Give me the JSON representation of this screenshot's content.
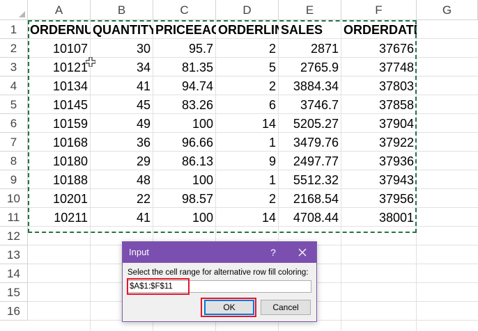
{
  "columns": [
    "A",
    "B",
    "C",
    "D",
    "E",
    "F",
    "G"
  ],
  "rows": [
    "1",
    "2",
    "3",
    "4",
    "5",
    "6",
    "7",
    "8",
    "9",
    "10",
    "11",
    "12",
    "13",
    "14",
    "15",
    "16"
  ],
  "headers": [
    "ORDERNU",
    "QUANTITY",
    "PRICEEAC",
    "ORDERLIN",
    "SALES",
    "ORDERDATE"
  ],
  "data": [
    [
      "10107",
      "30",
      "95.7",
      "2",
      "2871",
      "37676"
    ],
    [
      "10121",
      "34",
      "81.35",
      "5",
      "2765.9",
      "37748"
    ],
    [
      "10134",
      "41",
      "94.74",
      "2",
      "3884.34",
      "37803"
    ],
    [
      "10145",
      "45",
      "83.26",
      "6",
      "3746.7",
      "37858"
    ],
    [
      "10159",
      "49",
      "100",
      "14",
      "5205.27",
      "37904"
    ],
    [
      "10168",
      "36",
      "96.66",
      "1",
      "3479.76",
      "37922"
    ],
    [
      "10180",
      "29",
      "86.13",
      "9",
      "2497.77",
      "37936"
    ],
    [
      "10188",
      "48",
      "100",
      "1",
      "5512.32",
      "37943"
    ],
    [
      "10201",
      "22",
      "98.57",
      "2",
      "2168.54",
      "37956"
    ],
    [
      "10211",
      "41",
      "100",
      "14",
      "4708.44",
      "38001"
    ]
  ],
  "dialog": {
    "title": "Input",
    "help": "?",
    "prompt": "Select the cell range for alternative row fill coloring:",
    "input_value": "$A$1:$F$11",
    "ok_label": "OK",
    "cancel_label": "Cancel"
  },
  "colors": {
    "title_bar": "#7b4fb0",
    "highlight": "#e8142a",
    "marquee": "#217346"
  },
  "icons": [
    "close-icon",
    "cell-cursor-icon",
    "select-all-icon"
  ]
}
